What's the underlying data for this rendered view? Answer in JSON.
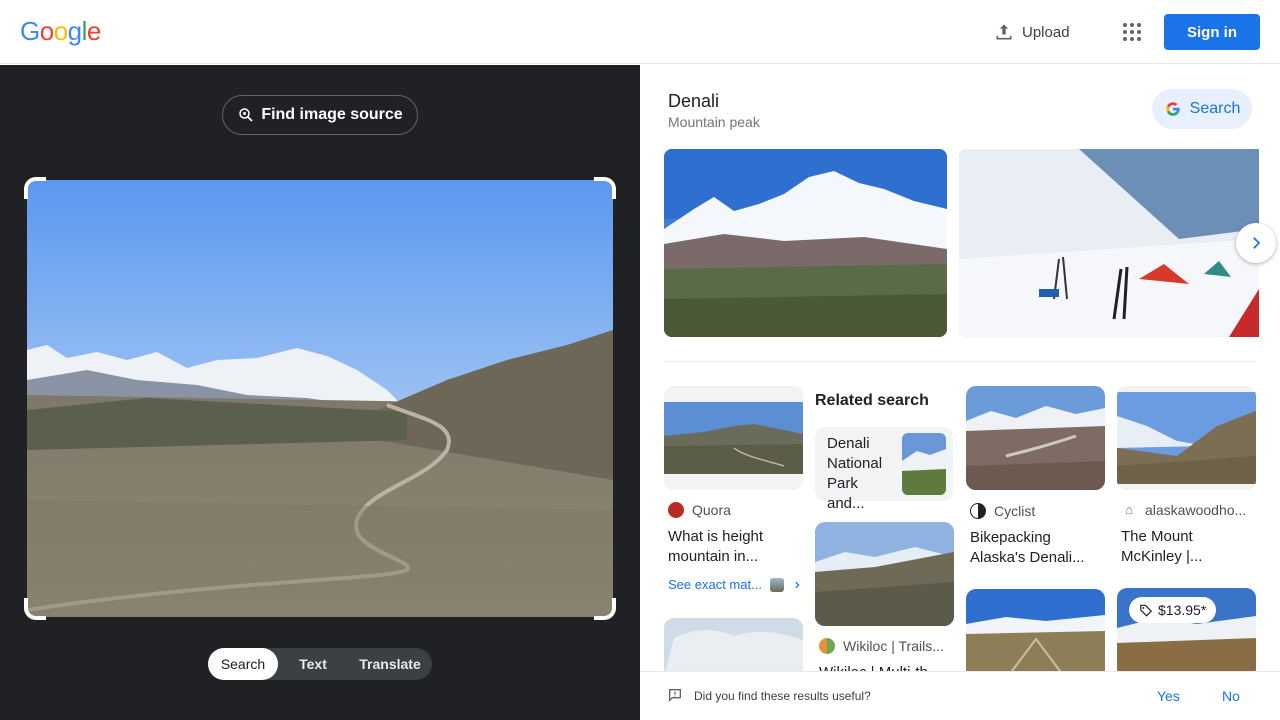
{
  "header": {
    "logo_letters": [
      {
        "ch": "G",
        "color": "#4285F4"
      },
      {
        "ch": "o",
        "color": "#EA4335"
      },
      {
        "ch": "o",
        "color": "#FBBC05"
      },
      {
        "ch": "g",
        "color": "#4285F4"
      },
      {
        "ch": "l",
        "color": "#34A853"
      },
      {
        "ch": "e",
        "color": "#EA4335"
      }
    ],
    "upload_label": "Upload",
    "apps_icon": "apps-grid-icon",
    "signin_label": "Sign in"
  },
  "left_panel": {
    "find_source_label": "Find image source",
    "modes": [
      {
        "label": "Search",
        "active": true
      },
      {
        "label": "Text",
        "active": false
      },
      {
        "label": "Translate",
        "active": false
      }
    ]
  },
  "entity": {
    "title": "Denali",
    "subtitle": "Mountain peak",
    "search_label": "Search"
  },
  "results": {
    "col1": [
      {
        "source": "Quora",
        "title_line1": "What is height",
        "title_line2": "mountain in..."
      }
    ],
    "see_exact_label": "See exact mat...",
    "related_label": "Related search",
    "related": {
      "line1": "Denali",
      "line2": "National",
      "line3": "Park and..."
    },
    "col2_bottom": {
      "source": "Wikiloc | Trails...",
      "title": "Wikiloc | Multi-th"
    },
    "col3": {
      "source": "Cyclist",
      "title_line1": "Bikepacking",
      "title_line2": "Alaska's Denali..."
    },
    "col4": {
      "source": "alaskawoodho...",
      "title_line1": "The Mount",
      "title_line2": "McKinley |..."
    },
    "price": "$13.95*"
  },
  "feedback": {
    "question": "Did you find these results useful?",
    "yes": "Yes",
    "no": "No"
  },
  "colors": {
    "accent": "#1a73e8",
    "dark_panel": "#202124"
  }
}
